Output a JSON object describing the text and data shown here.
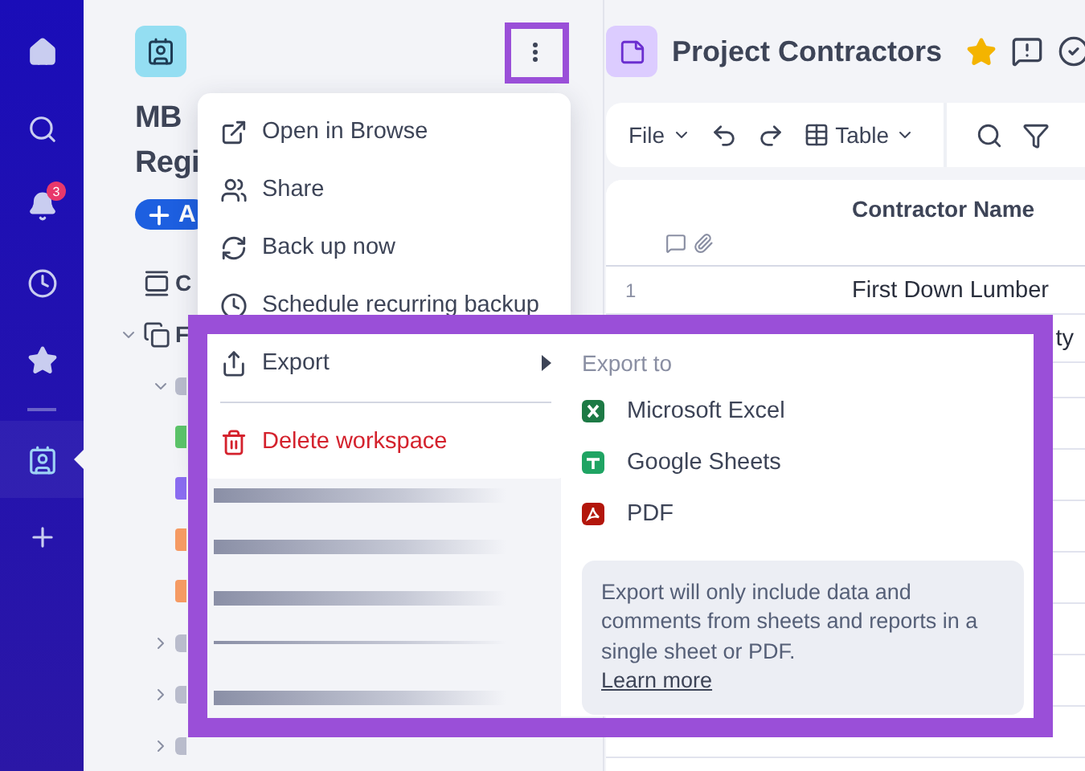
{
  "rail": {
    "items": [
      {
        "kind": "home",
        "selected": false
      },
      {
        "kind": "search",
        "selected": false
      },
      {
        "kind": "bell",
        "selected": false,
        "badge": "3"
      },
      {
        "kind": "clock",
        "selected": false
      },
      {
        "kind": "star",
        "selected": false
      },
      {
        "kind": "divider"
      },
      {
        "kind": "workspace",
        "selected": true
      },
      {
        "kind": "plus",
        "selected": false
      }
    ]
  },
  "sidebar": {
    "title_lines": [
      "MB",
      "Regi"
    ],
    "add_button": "A",
    "tree": [
      {
        "label": "C",
        "kind": "stack"
      },
      {
        "label": "F",
        "kind": "copy",
        "expanded": true,
        "children": [
          {
            "kind": "folder",
            "expanded": true,
            "color": "#b9bccc",
            "children": [
              {
                "kind": "sheet",
                "color": "#5cc46a"
              },
              {
                "kind": "sheet",
                "color": "#8a6cf0"
              },
              {
                "kind": "sheet",
                "color": "#f59a63"
              },
              {
                "kind": "sheet",
                "color": "#f59a63"
              }
            ]
          },
          {
            "kind": "folder",
            "expanded": false,
            "color": "#b9bccc"
          },
          {
            "kind": "folder",
            "expanded": false,
            "color": "#b9bccc"
          },
          {
            "kind": "folder",
            "expanded": false,
            "color": "#b9bccc"
          }
        ]
      }
    ]
  },
  "sheet": {
    "title": "Project Contractors",
    "favorite": true,
    "toolbar": {
      "file": "File",
      "view": "Table"
    },
    "table": {
      "columns": [
        "Contractor Name"
      ],
      "rows": [
        {
          "number": "1",
          "name": "First Down Lumber",
          "cut_left": false
        },
        {
          "name": "ty",
          "cut_left": true
        }
      ]
    }
  },
  "menu": {
    "items": [
      {
        "kind": "open",
        "label": "Open in Browse",
        "danger": false,
        "submenu": false
      },
      {
        "kind": "share",
        "label": "Share",
        "danger": false,
        "submenu": false
      },
      {
        "kind": "backup",
        "label": "Back up now",
        "danger": false,
        "submenu": false
      },
      {
        "kind": "schedule",
        "label": "Schedule recurring backup",
        "danger": false,
        "submenu": false
      },
      {
        "kind": "export",
        "label": "Export",
        "danger": false,
        "submenu": true
      },
      {
        "kind": "divider"
      },
      {
        "kind": "delete",
        "label": "Delete workspace",
        "danger": true,
        "submenu": false
      }
    ]
  },
  "submenu": {
    "heading": "Export to",
    "items": [
      {
        "kind": "excel",
        "label": "Microsoft Excel",
        "color": "#1d7a45"
      },
      {
        "kind": "sheets",
        "label": "Google Sheets",
        "color": "#1fa463"
      },
      {
        "kind": "pdf",
        "label": "PDF",
        "color": "#b3160b"
      }
    ],
    "note": "Export will only include data and comments from sheets and reports in a single sheet or PDF.",
    "link": "Learn more"
  }
}
